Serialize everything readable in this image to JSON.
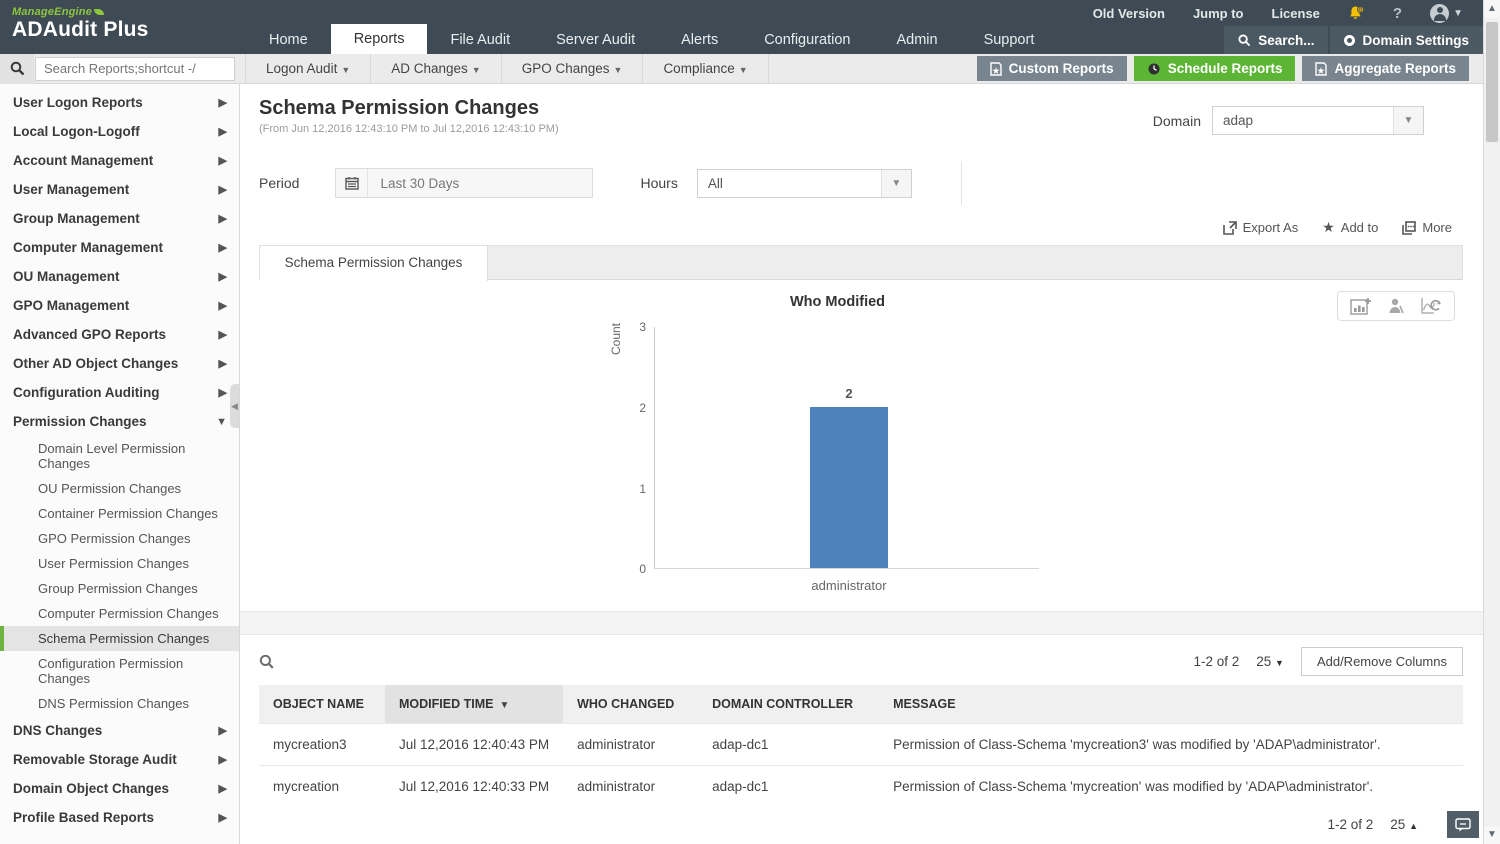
{
  "brand": {
    "company": "ManageEngine",
    "product": "ADAudit Plus"
  },
  "topbar": {
    "links": {
      "old_version": "Old Version",
      "jump_to": "Jump to",
      "license": "License"
    },
    "nav": [
      {
        "label": "Home"
      },
      {
        "label": "Reports"
      },
      {
        "label": "File Audit"
      },
      {
        "label": "Server Audit"
      },
      {
        "label": "Alerts"
      },
      {
        "label": "Configuration"
      },
      {
        "label": "Admin"
      },
      {
        "label": "Support"
      }
    ],
    "search_label": "Search...",
    "domain_settings_label": "Domain Settings"
  },
  "toolbar": {
    "search_placeholder": "Search Reports;shortcut -/",
    "menus": [
      {
        "label": "Logon Audit"
      },
      {
        "label": "AD Changes"
      },
      {
        "label": "GPO Changes"
      },
      {
        "label": "Compliance"
      }
    ],
    "buttons": [
      {
        "label": "Custom Reports"
      },
      {
        "label": "Schedule Reports"
      },
      {
        "label": "Aggregate Reports"
      }
    ]
  },
  "sidebar": {
    "items": [
      {
        "label": "User Logon Reports"
      },
      {
        "label": "Local Logon-Logoff"
      },
      {
        "label": "Account Management"
      },
      {
        "label": "User Management"
      },
      {
        "label": "Group Management"
      },
      {
        "label": "Computer Management"
      },
      {
        "label": "OU Management"
      },
      {
        "label": "GPO Management"
      },
      {
        "label": "Advanced GPO Reports"
      },
      {
        "label": "Other AD Object Changes"
      },
      {
        "label": "Configuration Auditing"
      },
      {
        "label": "Permission Changes",
        "expanded": true,
        "children": [
          {
            "label": "Domain Level Permission Changes"
          },
          {
            "label": "OU Permission Changes"
          },
          {
            "label": "Container Permission Changes"
          },
          {
            "label": "GPO Permission Changes"
          },
          {
            "label": "User Permission Changes"
          },
          {
            "label": "Group Permission Changes"
          },
          {
            "label": "Computer Permission Changes"
          },
          {
            "label": "Schema Permission Changes",
            "selected": true
          },
          {
            "label": "Configuration Permission Changes"
          },
          {
            "label": "DNS Permission Changes"
          }
        ]
      },
      {
        "label": "DNS Changes"
      },
      {
        "label": "Removable Storage Audit"
      },
      {
        "label": "Domain Object Changes"
      },
      {
        "label": "Profile Based Reports"
      }
    ]
  },
  "report": {
    "title": "Schema Permission Changes",
    "subtitle": "(From Jun 12,2016 12:43:10 PM to Jul 12,2016 12:43:10 PM)",
    "domain_label": "Domain",
    "domain_value": "adap",
    "period_label": "Period",
    "period_value": "Last 30 Days",
    "hours_label": "Hours",
    "hours_value": "All",
    "actions": {
      "export": "Export As",
      "add_to": "Add to",
      "more": "More"
    },
    "tab": "Schema Permission Changes"
  },
  "chart_data": {
    "type": "bar",
    "title": "Who Modified",
    "categories": [
      "administrator"
    ],
    "values": [
      2
    ],
    "xlabel": "",
    "ylabel": "Count",
    "yticks": [
      0,
      1,
      2,
      3
    ],
    "ylim": [
      0,
      3
    ],
    "bar_color": "#4e82bc",
    "grid": false,
    "legend": false
  },
  "table": {
    "pagination_top": {
      "range": "1-2 of 2",
      "page_size": "25"
    },
    "add_remove_label": "Add/Remove Columns",
    "columns": [
      "OBJECT NAME",
      "MODIFIED TIME",
      "WHO CHANGED",
      "DOMAIN CONTROLLER",
      "MESSAGE"
    ],
    "sorted_column": "MODIFIED TIME",
    "rows": [
      {
        "object_name": "mycreation3",
        "modified_time": "Jul 12,2016 12:40:43 PM",
        "who_changed": "administrator",
        "domain_controller": "adap-dc1",
        "message": "Permission of Class-Schema 'mycreation3' was modified by 'ADAP\\administrator'."
      },
      {
        "object_name": "mycreation",
        "modified_time": "Jul 12,2016 12:40:33 PM",
        "who_changed": "administrator",
        "domain_controller": "adap-dc1",
        "message": "Permission of Class-Schema 'mycreation' was modified by 'ADAP\\administrator'."
      }
    ],
    "pagination_bottom": {
      "range": "1-2 of 2",
      "page_size": "25"
    }
  },
  "colors": {
    "header_bg": "#3e4b54",
    "accent_green": "#5cb534",
    "selected_green": "#6db33f",
    "bar_blue": "#4e82bc",
    "button_gray": "#78858f"
  }
}
